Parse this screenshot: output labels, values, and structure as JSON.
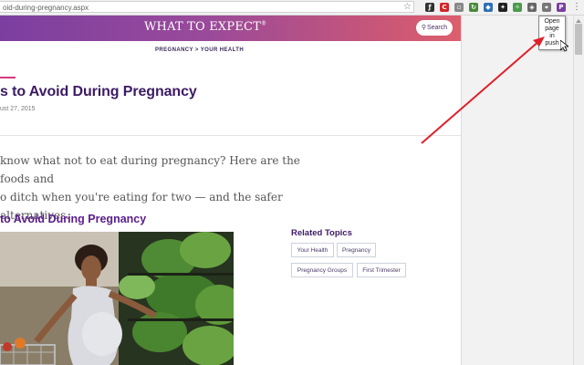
{
  "browser": {
    "url": "oid-during-pregnancy.aspx",
    "menu_label": "⋮"
  },
  "site": {
    "logo": "WHAT TO EXPECT",
    "logo_mark": "®",
    "search_label": "Search"
  },
  "tooltip": {
    "lines": [
      "Open",
      "page",
      "in",
      "push"
    ]
  },
  "article": {
    "breadcrumb": "PREGNANCY > YOUR HEALTH",
    "title": "s to Avoid During Pregnancy",
    "date": "ust 27, 2015",
    "lead_line1": "know what not to eat during pregnancy? Here are the foods and",
    "lead_line2": "o ditch when you're eating for two — and the safer alternatives.",
    "section_title": "to Avoid During Pregnancy"
  },
  "related": {
    "title": "Related Topics",
    "tags": [
      "Your Health",
      "Pregnancy",
      "Pregnancy Groups",
      "First Trimester"
    ]
  },
  "colors": {
    "header_start": "#7b3fa0",
    "header_end": "#dd5f6d",
    "title": "#3c1a64",
    "accent": "#d63a7b",
    "annotation_arrow": "#e0202a"
  }
}
